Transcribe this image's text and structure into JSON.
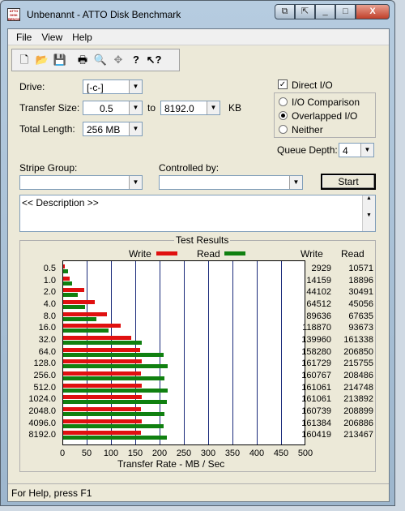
{
  "window": {
    "title": "Unbenannt - ATTO Disk Benchmark",
    "icon_text": "ATTO DISK BENCH"
  },
  "caption_buttons": [
    "⧉",
    "⇱",
    "_",
    "□",
    "X"
  ],
  "menu": [
    "File",
    "View",
    "Help"
  ],
  "toolbar": [
    "new-icon",
    "open-icon",
    "save-icon",
    "print-icon",
    "print-preview-icon",
    "move-icon",
    "help-icon",
    "context-help-icon"
  ],
  "form": {
    "drive_label": "Drive:",
    "drive_value": "[-c-]",
    "transfer_label": "Transfer Size:",
    "transfer_from": "0.5",
    "to_label": "to",
    "transfer_to": "8192.0",
    "kb_label": "KB",
    "length_label": "Total Length:",
    "length_value": "256 MB",
    "direct_io": "Direct I/O",
    "io_comparison": "I/O Comparison",
    "overlapped_io": "Overlapped I/O",
    "neither": "Neither",
    "queue_label": "Queue Depth:",
    "queue_value": "4",
    "stripe_label": "Stripe Group:",
    "controlled_label": "Controlled by:",
    "start": "Start",
    "description": "<< Description >>"
  },
  "results": {
    "title": "Test Results",
    "write_label": "Write",
    "read_label": "Read",
    "col_write": "Write",
    "col_read": "Read",
    "xlabel": "Transfer Rate - MB / Sec"
  },
  "chart_data": {
    "type": "bar",
    "categories": [
      "0.5",
      "1.0",
      "2.0",
      "4.0",
      "8.0",
      "16.0",
      "32.0",
      "64.0",
      "128.0",
      "256.0",
      "512.0",
      "1024.0",
      "2048.0",
      "4096.0",
      "8192.0"
    ],
    "series": [
      {
        "name": "Write",
        "color": "#e01010",
        "values": [
          2929,
          14159,
          44102,
          64512,
          89636,
          118870,
          139960,
          158280,
          161729,
          160767,
          161061,
          161061,
          160739,
          161384,
          160419
        ]
      },
      {
        "name": "Read",
        "color": "#108010",
        "values": [
          10571,
          18896,
          30491,
          45056,
          67635,
          93673,
          161338,
          206850,
          215755,
          208486,
          214748,
          213892,
          208899,
          206886,
          213467
        ]
      }
    ],
    "xticks": [
      "0",
      "50",
      "100",
      "150",
      "200",
      "250",
      "300",
      "350",
      "400",
      "450",
      "500"
    ],
    "xlim": [
      0,
      500
    ],
    "xlabel": "Transfer Rate - MB / Sec"
  },
  "status": "For Help, press F1"
}
